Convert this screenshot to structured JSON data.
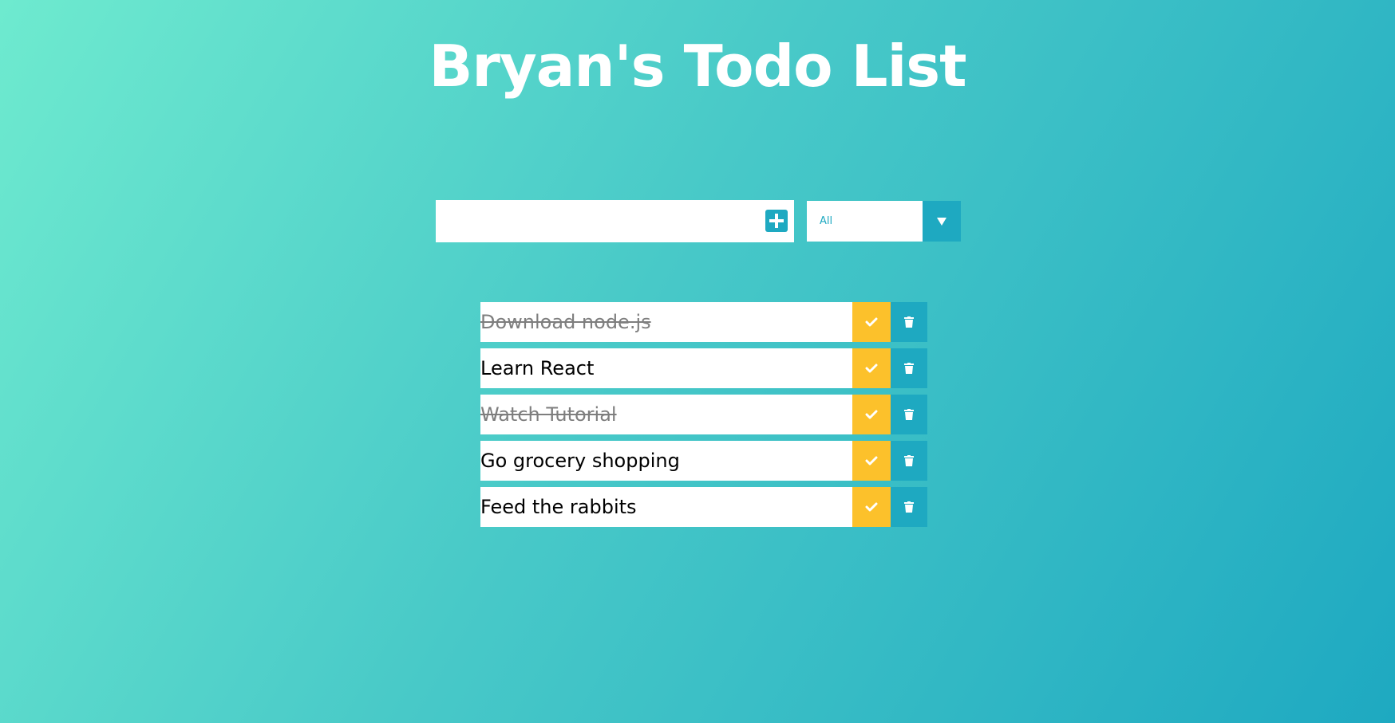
{
  "header": {
    "title": "Bryan's Todo List"
  },
  "form": {
    "input_value": "",
    "add_icon": "plus-square-icon",
    "filter_selected": "All",
    "filter_icon": "caret-down-icon"
  },
  "todos": [
    {
      "text": "Download node.js",
      "completed": true
    },
    {
      "text": "Learn React",
      "completed": false
    },
    {
      "text": "Watch Tutorial",
      "completed": true
    },
    {
      "text": "Go grocery shopping",
      "completed": false
    },
    {
      "text": "Feed the rabbits",
      "completed": false
    }
  ],
  "icons": {
    "complete": "check-icon",
    "delete": "trash-icon"
  },
  "colors": {
    "gradient_start": "#6eeacf",
    "gradient_end": "#1ea9c1",
    "accent": "#1ea9c1",
    "complete": "#fcc12b",
    "text": "#000000"
  }
}
